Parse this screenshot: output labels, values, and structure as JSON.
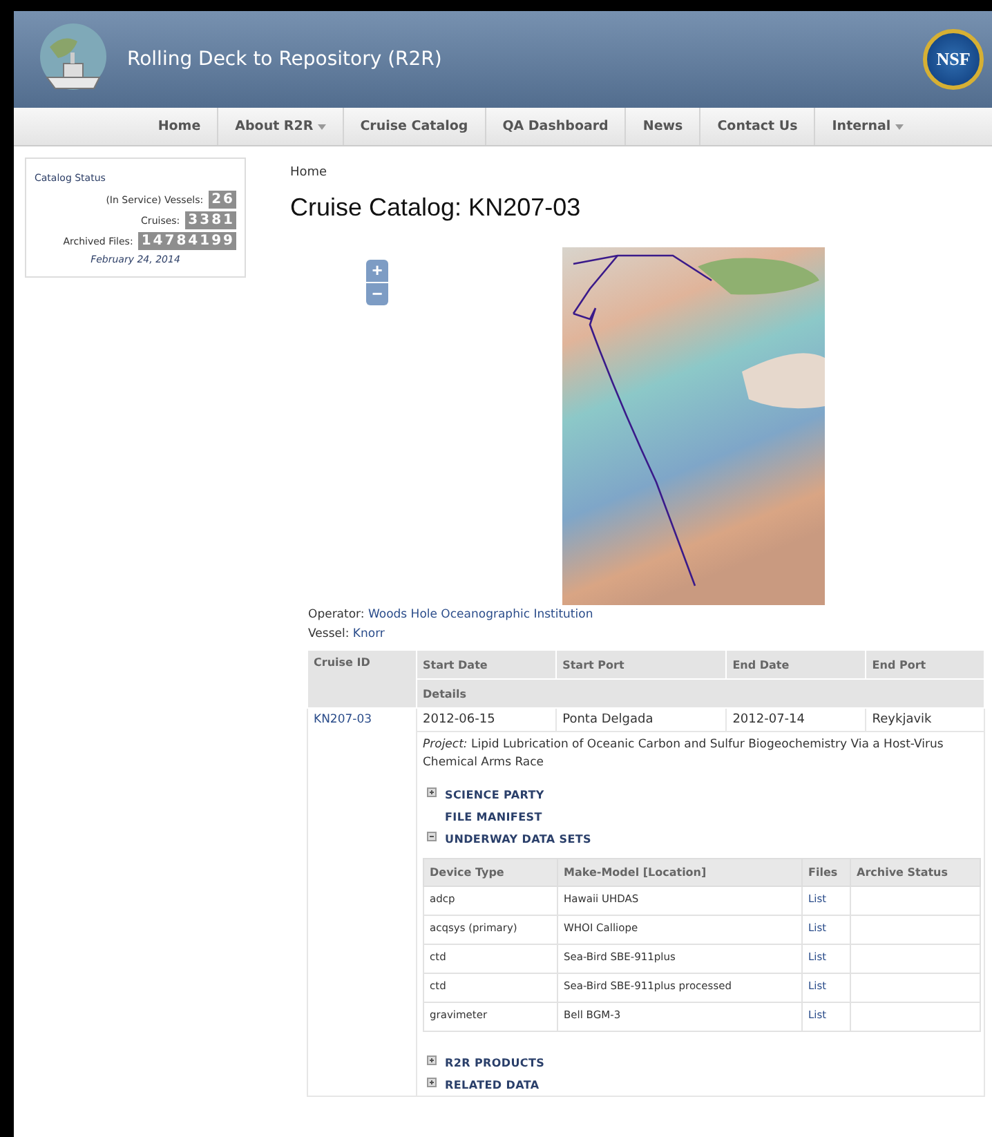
{
  "header": {
    "title": "Rolling Deck to Repository (R2R)",
    "seal_text": "NSF"
  },
  "nav": [
    {
      "label": "Home",
      "dropdown": false
    },
    {
      "label": "About R2R",
      "dropdown": true
    },
    {
      "label": "Cruise Catalog",
      "dropdown": false
    },
    {
      "label": "QA Dashboard",
      "dropdown": false
    },
    {
      "label": "News",
      "dropdown": false
    },
    {
      "label": "Contact Us",
      "dropdown": false
    },
    {
      "label": "Internal",
      "dropdown": true
    }
  ],
  "catalog_status": {
    "title": "Catalog Status",
    "stats": [
      {
        "label": "(In Service) Vessels:",
        "value": "26"
      },
      {
        "label": "Cruises:",
        "value": "3381"
      },
      {
        "label": "Archived Files:",
        "value": "14784199"
      }
    ],
    "date": "February 24, 2014"
  },
  "breadcrumb": "Home",
  "page_title": "Cruise Catalog: KN207-03",
  "map": {
    "zoom_in": "+",
    "zoom_out": "−"
  },
  "info": [
    {
      "label": "Operator:",
      "value": "Woods Hole Oceanographic Institution"
    },
    {
      "label": "Vessel:",
      "value": "Knorr"
    }
  ],
  "cruise_table": {
    "columns": [
      "Cruise ID",
      "Start Date",
      "Start Port",
      "End Date",
      "End Port"
    ],
    "details_header": "Details",
    "row": {
      "cruise_id": "KN207-03",
      "start_date": "2012-06-15",
      "start_port": "Ponta Delgada",
      "end_date": "2012-07-14",
      "end_port": "Reykjavik",
      "project_label": "Project:",
      "project": "Lipid Lubrication of Oceanic Carbon and Sulfur Biogeochemistry Via a Host-Virus Chemical Arms Race"
    }
  },
  "sections_top": [
    {
      "label": "SCIENCE PARTY",
      "kind": "toggle",
      "expanded": false
    },
    {
      "label": "FILE MANIFEST",
      "kind": "link"
    },
    {
      "label": "UNDERWAY DATA SETS",
      "kind": "toggle",
      "expanded": true
    }
  ],
  "datasets": {
    "columns": [
      "Device Type",
      "Make-Model [Location]",
      "Files",
      "Archive Status"
    ],
    "rows": [
      {
        "device": "adcp",
        "model": "Hawaii UHDAS",
        "files": "List"
      },
      {
        "device": "acqsys (primary)",
        "model": "WHOI Calliope",
        "files": "List"
      },
      {
        "device": "ctd",
        "model": "Sea-Bird SBE-911plus",
        "files": "List"
      },
      {
        "device": "ctd",
        "model": "Sea-Bird SBE-911plus processed",
        "files": "List"
      },
      {
        "device": "gravimeter",
        "model": "Bell BGM-3",
        "files": "List"
      }
    ]
  },
  "sections_bottom": [
    {
      "label": "R2R PRODUCTS",
      "kind": "toggle",
      "expanded": false
    },
    {
      "label": "RELATED DATA",
      "kind": "toggle",
      "expanded": false
    }
  ]
}
